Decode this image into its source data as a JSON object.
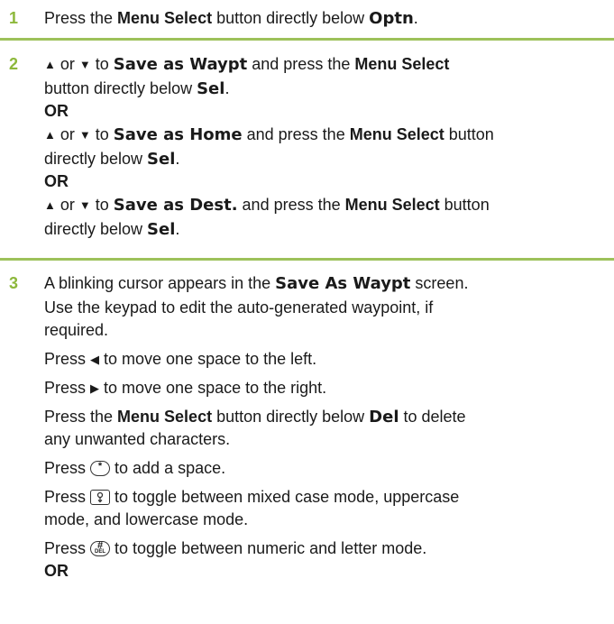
{
  "colors": {
    "step_number": "#8db83b",
    "rule": "#9dc15a",
    "text": "#1a1a1a"
  },
  "step1": {
    "number": "1",
    "l1_a": "Press the ",
    "l1_b": "Menu Select",
    "l1_c": " button directly below ",
    "l1_d": "Optn",
    "l1_e": "."
  },
  "step2": {
    "number": "2",
    "up_icon": "arrow-up-icon",
    "down_icon": "arrow-down-icon",
    "or_word": " or ",
    "a_to": " to ",
    "a_screen": "Save as Waypt",
    "a_press": " and press the ",
    "a_menu": "Menu Select",
    "a_l2": "button directly below ",
    "a_sel": "Sel",
    "a_end": ".",
    "or1": "OR",
    "b_screen": "Save as Home",
    "b_press": " and press the ",
    "b_menu": "Menu Select",
    "b_button": " button",
    "b_l2": "directly below ",
    "b_sel": "Sel",
    "b_end": ".",
    "or2": "OR",
    "c_screen": "Save as Dest.",
    "c_press": " and press the ",
    "c_menu": "Menu Select",
    "c_button": " button",
    "c_l2": "directly below ",
    "c_sel": "Sel",
    "c_end": "."
  },
  "step3": {
    "number": "3",
    "l1_a": "A blinking cursor appears in the ",
    "l1_b": "Save As Waypt",
    "l1_c": " screen.",
    "l2": "Use the keypad to edit the auto-generated waypoint, if",
    "l3": "required.",
    "left_a": "Press ",
    "left_b": " to move one space to the left.",
    "right_a": "Press ",
    "right_b": " to move one space to the right.",
    "del_a": "Press the ",
    "del_b": "Menu Select",
    "del_c": " button directly below ",
    "del_d": "Del",
    "del_e": " to delete",
    "del_l2": "any unwanted characters.",
    "star_a": "Press ",
    "star_b": " to add a space.",
    "star_key": "*",
    "case_a": "Press ",
    "case_b": " to toggle between mixed case mode, uppercase",
    "case_l2": "mode, and lowercase mode.",
    "hash_a": "Press ",
    "hash_b": " to toggle between numeric and letter mode.",
    "hash_key": "#",
    "hash_sub": "DEL",
    "or": "OR"
  }
}
